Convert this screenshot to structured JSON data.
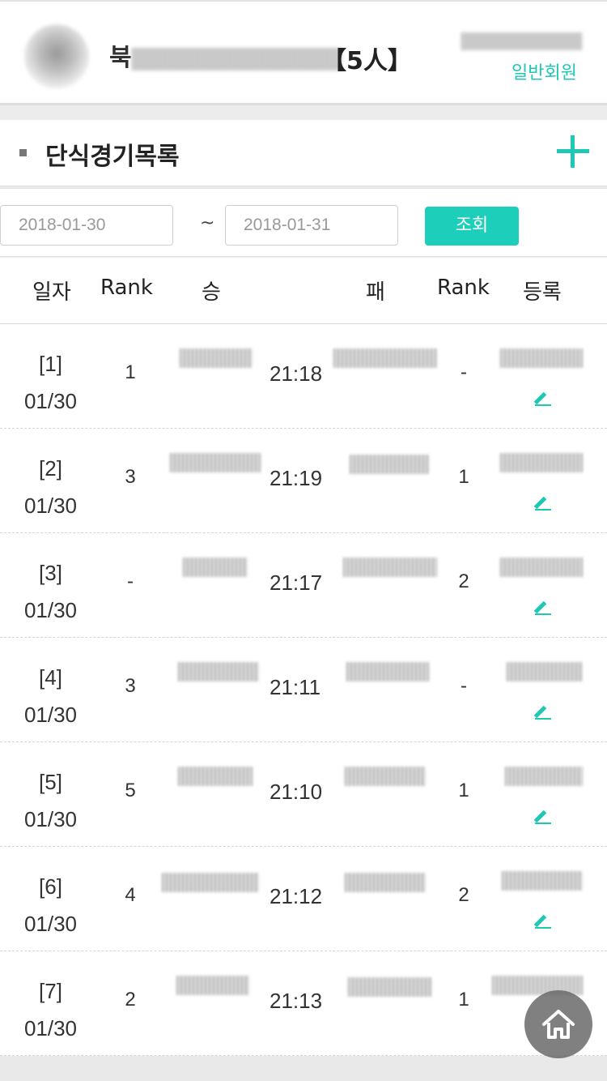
{
  "header": {
    "club_name_prefix": "북",
    "member_count": "【5人】",
    "member_type": "일반회원"
  },
  "section": {
    "title": "단식경기목록"
  },
  "filter": {
    "start_date": "2018-01-30",
    "end_date": "2018-01-31",
    "separator": "~",
    "search_label": "조회"
  },
  "table": {
    "headers": [
      "일자",
      "Rank",
      "승",
      "패",
      "Rank",
      "등록"
    ],
    "rows": [
      {
        "no": "[1]",
        "date": "01/30",
        "win_rank": "1",
        "time": "21:18",
        "lose_rank": "-"
      },
      {
        "no": "[2]",
        "date": "01/30",
        "win_rank": "3",
        "time": "21:19",
        "lose_rank": "1"
      },
      {
        "no": "[3]",
        "date": "01/30",
        "win_rank": "-",
        "time": "21:17",
        "lose_rank": "2"
      },
      {
        "no": "[4]",
        "date": "01/30",
        "win_rank": "3",
        "time": "21:11",
        "lose_rank": "-"
      },
      {
        "no": "[5]",
        "date": "01/30",
        "win_rank": "5",
        "time": "21:10",
        "lose_rank": "1"
      },
      {
        "no": "[6]",
        "date": "01/30",
        "win_rank": "4",
        "time": "21:12",
        "lose_rank": "2"
      },
      {
        "no": "[7]",
        "date": "01/30",
        "win_rank": "2",
        "time": "21:13",
        "lose_rank": "1"
      }
    ]
  },
  "icons": {
    "add": "plus-icon",
    "edit": "pencil-icon",
    "home": "home-icon"
  },
  "colors": {
    "accent": "#1fc7b5",
    "button": "#1dcfba"
  }
}
